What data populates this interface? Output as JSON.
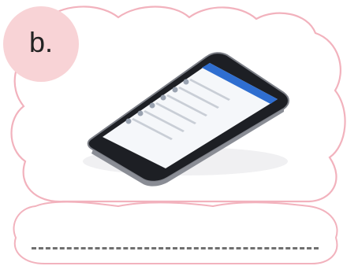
{
  "badge": {
    "label": "b."
  },
  "colors": {
    "cloud_outline": "#f2b2bd",
    "badge_fill": "#f8d3d6",
    "phone_body": "#1d1f24",
    "app_header": "#2f6ed0",
    "answer_line": "#6f6f6f"
  },
  "answer": {
    "value": ""
  }
}
